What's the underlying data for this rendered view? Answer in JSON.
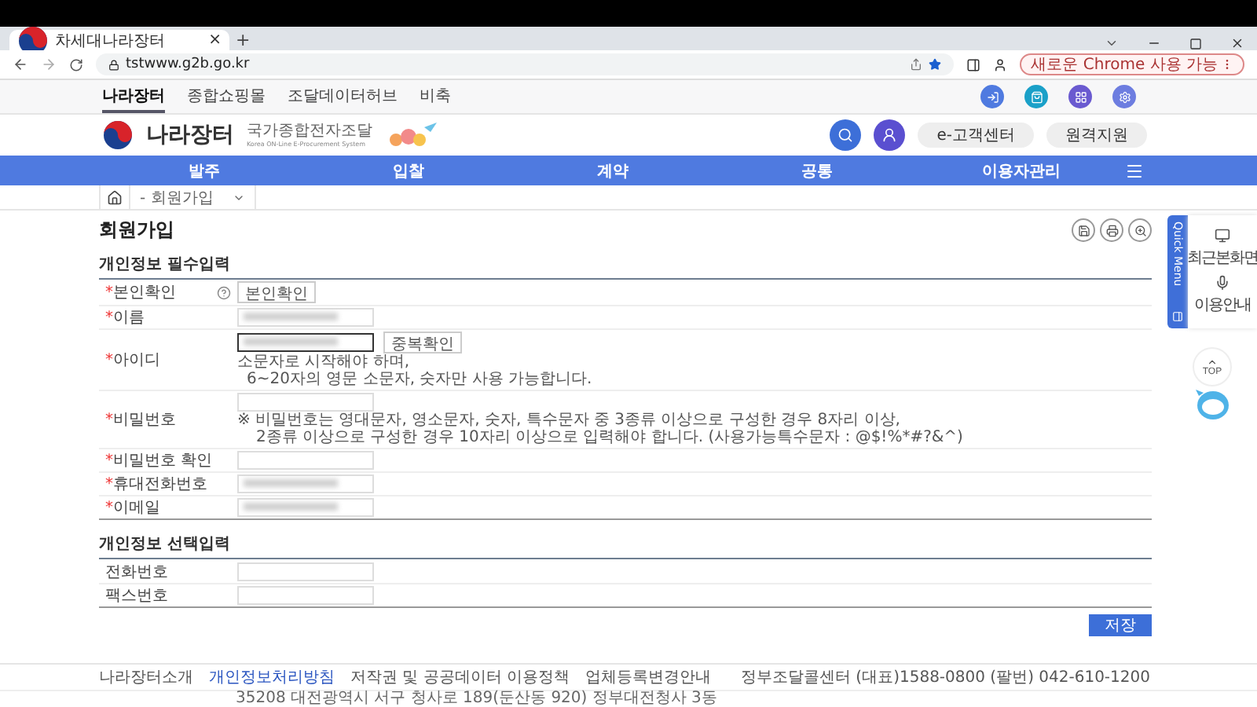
{
  "browser": {
    "tab_title": "차세대나라장터",
    "tab_close": "×",
    "new_tab": "+",
    "url": "tstwww.g2b.go.kr",
    "update_button": "새로운 Chrome 사용 가능"
  },
  "gnb": [
    {
      "label": "나라장터",
      "selected": true
    },
    {
      "label": "종합쇼핑몰",
      "selected": false
    },
    {
      "label": "조달데이터허브",
      "selected": false
    },
    {
      "label": "비축",
      "selected": false
    }
  ],
  "header": {
    "logo_title": "나라장터",
    "logo_subtitle": "국가종합전자조달",
    "logo_caption": "Korea ON-Line E-Procurement System",
    "buttons": [
      "e-고객센터",
      "원격지원"
    ]
  },
  "nav": [
    "발주",
    "입찰",
    "계약",
    "공통",
    "이용자관리"
  ],
  "breadcrumb": "- 회원가입",
  "page_title": "회원가입",
  "required_mark": "*",
  "sections": [
    {
      "title": "개인정보 필수입력",
      "rows": [
        {
          "kind": "verify",
          "label": "본인확인",
          "required": true,
          "button": "본인확인"
        },
        {
          "kind": "field",
          "label": "이름",
          "required": true,
          "redacted": true
        },
        {
          "kind": "id",
          "label": "아이디",
          "required": true,
          "redacted": true,
          "focused": true,
          "button": "중복확인",
          "notes": [
            "소문자로 시작해야 하며,",
            "6~20자의 영문 소문자, 숫자만 사용 가능합니다."
          ]
        },
        {
          "kind": "password",
          "label": "비밀번호",
          "required": true,
          "redacted": false,
          "notes": [
            "※ 비밀번호는 영대문자, 영소문자, 숫자, 특수문자 중 3종류 이상으로 구성한 경우 8자리 이상,",
            "2종류 이상으로 구성한 경우 10자리 이상으로 입력해야 합니다. (사용가능특수문자 : @$!%*#?&^)"
          ]
        },
        {
          "kind": "field",
          "label": "비밀번호 확인",
          "required": true,
          "redacted": false
        },
        {
          "kind": "field",
          "label": "휴대전화번호",
          "required": true,
          "redacted": true
        },
        {
          "kind": "field",
          "label": "이메일",
          "required": true,
          "redacted": true
        }
      ]
    },
    {
      "title": "개인정보 선택입력",
      "rows": [
        {
          "kind": "field",
          "label": "전화번호",
          "required": false,
          "redacted": false
        },
        {
          "kind": "field",
          "label": "팩스번호",
          "required": false,
          "redacted": false
        }
      ]
    }
  ],
  "save_button": "저장",
  "quick_menu": {
    "title": "Quick Menu",
    "items": [
      "최근본화면",
      "이용안내"
    ],
    "top": "TOP"
  },
  "footer": {
    "links": [
      {
        "label": "나라장터소개",
        "highlight": false
      },
      {
        "label": "개인정보처리방침",
        "highlight": true
      },
      {
        "label": "저작권 및 공공데이터 이용정책",
        "highlight": false
      },
      {
        "label": "업체등록변경안내",
        "highlight": false
      }
    ],
    "contact": "정부조달콜센터 (대표)1588-0800 (팔번) 042-610-1200",
    "address": "35208 대전광역시 서구 청사로 189(둔산동 920) 정부대전청사 3동"
  }
}
